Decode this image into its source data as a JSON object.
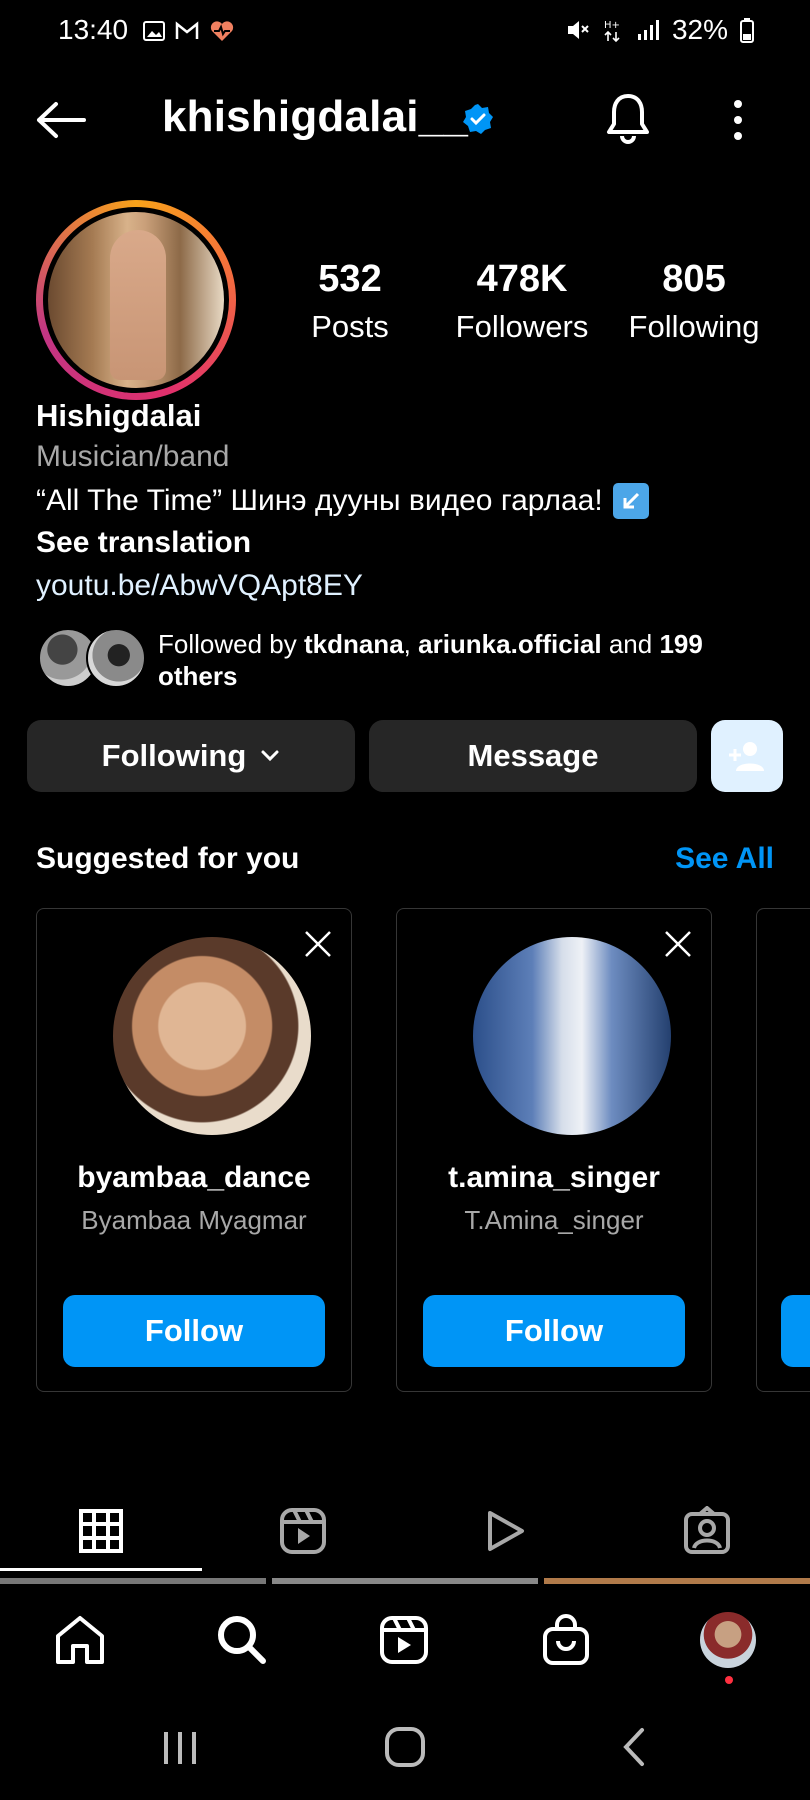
{
  "status_bar": {
    "time": "13:40",
    "battery": "32%"
  },
  "header": {
    "username": "khishigdalai__"
  },
  "profile": {
    "stats": [
      {
        "value": "532",
        "label": "Posts"
      },
      {
        "value": "478K",
        "label": "Followers"
      },
      {
        "value": "805",
        "label": "Following"
      }
    ],
    "display_name": "Hishigdalai",
    "category": "Musician/band",
    "bio": "“All The Time” Шинэ дууны видео гарлаа!",
    "see_translation": "See translation",
    "link": "youtu.be/AbwVQApt8EY",
    "followed_by": {
      "prefix": "Followed by ",
      "user1": "tkdnana",
      "sep": ", ",
      "user2": "ariunka.official",
      "and": " and ",
      "others": "199 others"
    }
  },
  "actions": {
    "following": "Following",
    "message": "Message"
  },
  "suggested": {
    "title": "Suggested for you",
    "see_all": "See All",
    "cards": [
      {
        "username": "byambaa_dance",
        "name": "Byambaa Myagmar",
        "button": "Follow"
      },
      {
        "username": "t.amina_singer",
        "name": "T.Amina_singer",
        "button": "Follow"
      }
    ]
  },
  "colors": {
    "accent": "#0095f6",
    "button_bg": "#262626",
    "muted": "#a8a8a8"
  }
}
